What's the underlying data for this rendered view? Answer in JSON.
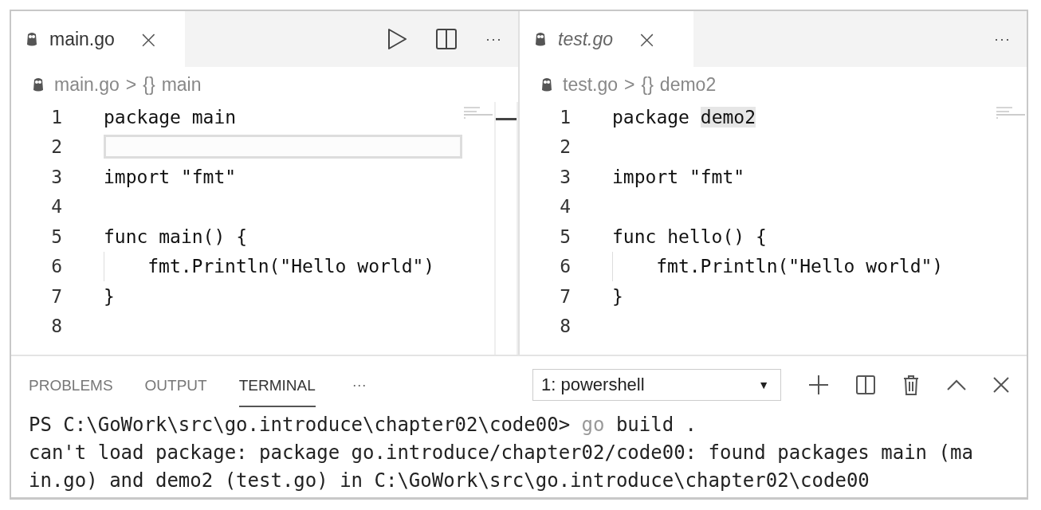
{
  "editors": [
    {
      "tab": {
        "label": "main.go",
        "preview": false,
        "close": "×"
      },
      "actions": [
        {
          "kind": "run"
        },
        {
          "kind": "split"
        },
        {
          "kind": "more",
          "label": "···"
        }
      ],
      "breadcrumb": {
        "file": "main.go",
        "separator": ">",
        "symbol_icon": "{}",
        "symbol": "main"
      },
      "minimap_scrollbar": true,
      "lines": [
        {
          "number": "1",
          "current": false,
          "segments": [
            {
              "text": "package main",
              "highlighted": false
            }
          ]
        },
        {
          "number": "2",
          "current": true
        },
        {
          "number": "3",
          "current": false,
          "segments": [
            {
              "text": "import \"fmt\"",
              "highlighted": false
            }
          ]
        },
        {
          "number": "4",
          "current": false
        },
        {
          "number": "5",
          "current": false,
          "segments": [
            {
              "text": "func main() {",
              "highlighted": false
            }
          ]
        },
        {
          "number": "6",
          "current": false,
          "segments": [
            {
              "text": "    fmt.Println(\"Hello world\")",
              "highlighted": false
            }
          ]
        },
        {
          "number": "7",
          "current": false,
          "segments": [
            {
              "text": "}",
              "highlighted": false
            }
          ]
        },
        {
          "number": "8",
          "current": false
        }
      ]
    },
    {
      "tab": {
        "label": "test.go",
        "preview": true,
        "close": "×"
      },
      "actions": [
        {
          "kind": "more",
          "label": "···"
        }
      ],
      "breadcrumb": {
        "file": "test.go",
        "separator": ">",
        "symbol_icon": "{}",
        "symbol": "demo2"
      },
      "lines": [
        {
          "number": "1",
          "current": false,
          "segments": [
            {
              "text": "package ",
              "highlighted": false
            },
            {
              "text": "demo2",
              "highlighted": true
            }
          ]
        },
        {
          "number": "2",
          "current": false
        },
        {
          "number": "3",
          "current": false,
          "segments": [
            {
              "text": "import \"fmt\"",
              "highlighted": false
            }
          ]
        },
        {
          "number": "4",
          "current": false
        },
        {
          "number": "5",
          "current": false,
          "segments": [
            {
              "text": "func hello() {",
              "highlighted": false
            }
          ]
        },
        {
          "number": "6",
          "current": false,
          "segments": [
            {
              "text": "    fmt.Println(\"Hello world\")",
              "highlighted": false
            }
          ]
        },
        {
          "number": "7",
          "current": false,
          "segments": [
            {
              "text": "}",
              "highlighted": false
            }
          ]
        },
        {
          "number": "8",
          "current": false
        }
      ]
    }
  ],
  "panel": {
    "tabs": [
      {
        "label": "PROBLEMS",
        "selected": false
      },
      {
        "label": "OUTPUT",
        "selected": false
      },
      {
        "label": "TERMINAL",
        "selected": true
      }
    ],
    "more": "···",
    "terminal_select": {
      "value": "1: powershell",
      "caret": "▼"
    },
    "actions": [
      {
        "kind": "add"
      },
      {
        "kind": "split"
      },
      {
        "kind": "trash"
      },
      {
        "kind": "maximize"
      },
      {
        "kind": "close"
      }
    ],
    "terminal_lines": [
      [
        {
          "text": "PS C:\\GoWork\\src\\go.introduce\\chapter02\\code00> ",
          "dim": false
        },
        {
          "text": "go",
          "dim": true
        },
        {
          "text": " build .",
          "dim": false
        }
      ],
      [
        {
          "text": "can't load package: package go.introduce/chapter02/code00: found packages main (ma",
          "dim": false
        }
      ],
      [
        {
          "text": "in.go) and demo2 (test.go) in C:\\GoWork\\src\\go.introduce\\chapter02\\code00",
          "dim": false
        }
      ]
    ]
  }
}
